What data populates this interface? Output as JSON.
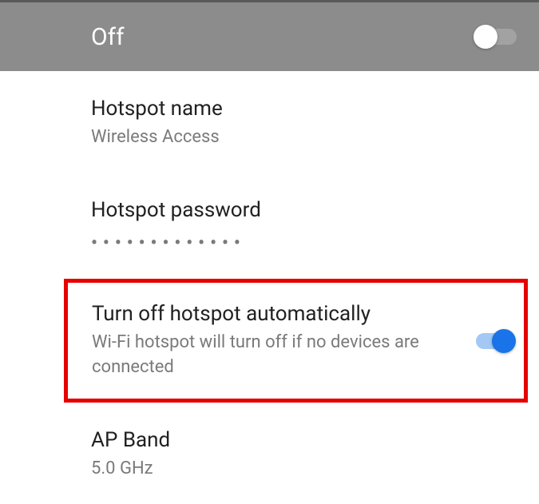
{
  "header": {
    "status_label": "Off",
    "toggle_state": false
  },
  "settings": {
    "hotspot_name": {
      "title": "Hotspot name",
      "value": "Wireless Access"
    },
    "hotspot_password": {
      "title": "Hotspot password",
      "masked_value": "•••••••••••••"
    },
    "auto_off": {
      "title": "Turn off hotspot automatically",
      "description": "Wi-Fi hotspot will turn off if no devices are connected",
      "toggle_state": true,
      "highlighted": true
    },
    "ap_band": {
      "title": "AP Band",
      "value": "5.0 GHz"
    }
  }
}
